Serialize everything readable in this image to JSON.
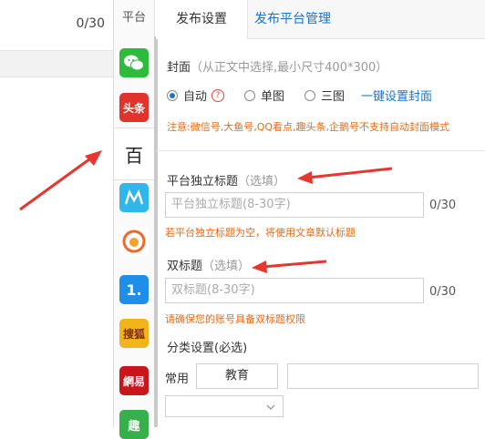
{
  "left": {
    "counter": "0/30"
  },
  "platforms": {
    "header": "平台",
    "items": [
      {
        "name": "wechat",
        "icon": "wechat-icon",
        "color": "#2dbb3c"
      },
      {
        "name": "toutiao",
        "icon": "toutiao-icon",
        "label": "头条",
        "color": "#e1322d"
      },
      {
        "name": "baijiahao",
        "icon": "baidu-icon",
        "label": "百",
        "color": "#ffffff",
        "selected": true
      },
      {
        "name": "dayu",
        "icon": "dayu-icon",
        "color": "#2fb7ea"
      },
      {
        "name": "uc",
        "icon": "fire-icon",
        "color": "#f2672a"
      },
      {
        "name": "yidian",
        "icon": "yidian-icon",
        "label": "1.",
        "color": "#1f8ee8"
      },
      {
        "name": "sohu",
        "icon": "sohu-icon",
        "label": "搜狐",
        "color": "#f2b41a"
      },
      {
        "name": "netease",
        "icon": "netease-icon",
        "label": "網易",
        "color": "#c9161b"
      },
      {
        "name": "qutoutiao",
        "icon": "qu-icon",
        "label": "趣",
        "color": "#35b04a"
      }
    ]
  },
  "tabs": {
    "active": "发布设置",
    "other": "发布平台管理"
  },
  "cover": {
    "label": "封面",
    "hint": "（从正文中选择,最小尺寸400*300）",
    "options": [
      "自动",
      "单图",
      "三图"
    ],
    "link": "一键设置封面",
    "notice": "注意:微信号,大鱼号,QQ看点,趣头条,企鹅号不支持自动封面模式"
  },
  "independent_title": {
    "label": "平台独立标题",
    "hint": "（选填）",
    "placeholder": "平台独立标题(8-30字)",
    "counter": "0/30",
    "tip": "若平台独立标题为空，将使用文章默认标题"
  },
  "double_title": {
    "label": "双标题",
    "hint": "（选填）",
    "placeholder": "双标题(8-30字)",
    "counter": "0/30",
    "tip": "请确保您的账号具备双标题权限"
  },
  "category": {
    "label": "分类设置(必选)",
    "common_label": "常用",
    "common_tag": "教育"
  },
  "colors": {
    "accent": "#1a73c9",
    "warning": "#e96a14",
    "arrow": "#e5362f"
  }
}
